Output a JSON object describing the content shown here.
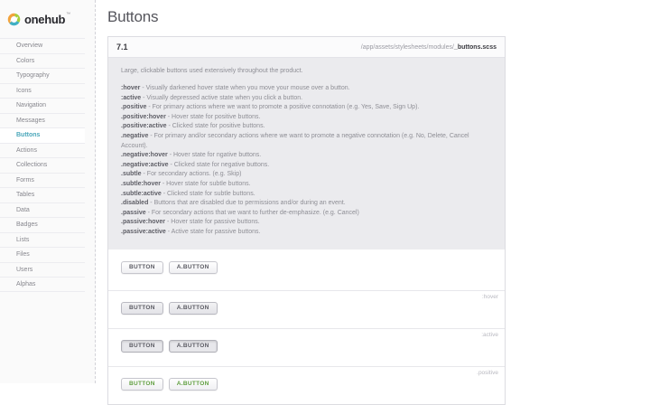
{
  "theme": {
    "accent_teal": "#4ba7ba",
    "positive_green": "#5f9e3e"
  },
  "brand": {
    "name": "onehub",
    "tm": "™"
  },
  "sidebar": {
    "items": [
      {
        "label": "Overview",
        "active": false
      },
      {
        "label": "Colors",
        "active": false
      },
      {
        "label": "Typography",
        "active": false
      },
      {
        "label": "Icons",
        "active": false
      },
      {
        "label": "Navigation",
        "active": false
      },
      {
        "label": "Messages",
        "active": false
      },
      {
        "label": "Buttons",
        "active": true
      },
      {
        "label": "Actions",
        "active": false
      },
      {
        "label": "Collections",
        "active": false
      },
      {
        "label": "Forms",
        "active": false
      },
      {
        "label": "Tables",
        "active": false
      },
      {
        "label": "Data",
        "active": false
      },
      {
        "label": "Badges",
        "active": false
      },
      {
        "label": "Lists",
        "active": false
      },
      {
        "label": "Files",
        "active": false
      },
      {
        "label": "Users",
        "active": false
      },
      {
        "label": "Alphas",
        "active": false
      }
    ]
  },
  "page": {
    "title": "Buttons"
  },
  "section": {
    "number": "7.1",
    "path_prefix": "/app/assets/stylesheets/modules/",
    "path_file": "_buttons.scss",
    "intro": "Large, clickable buttons used extensively throughout the product.",
    "definitions": [
      {
        "term": ":hover",
        "desc": "- Visually darkened hover state when you move your mouse over a button."
      },
      {
        "term": ":active",
        "desc": "- Visually depressed active state when you click a button."
      },
      {
        "term": ".positive",
        "desc": "- For primary actions where we want to promote a positive connotation (e.g. Yes, Save, Sign Up)."
      },
      {
        "term": ".positive:hover",
        "desc": "- Hover state for positive buttons."
      },
      {
        "term": ".positive:active",
        "desc": "- Clicked state for positive buttons."
      },
      {
        "term": ".negative",
        "desc": "- For primary and/or secondary actions where we want to promote a negative connotation (e.g. No, Delete, Cancel Account)."
      },
      {
        "term": ".negative:hover",
        "desc": "- Hover state for ngative buttons."
      },
      {
        "term": ".negative:active",
        "desc": "- Clicked state for negative buttons."
      },
      {
        "term": ".subtle",
        "desc": "- For secondary actions. (e.g. Skip)"
      },
      {
        "term": ".subtle:hover",
        "desc": "- Hover state for subtle buttons."
      },
      {
        "term": ".subtle:active",
        "desc": "- Clicked state for subtle buttons."
      },
      {
        "term": ".disabled",
        "desc": "- Buttons that are disabled due to permissions and/or during an event."
      },
      {
        "term": ".passive",
        "desc": "- For secondary actions that we want to further de-emphasize. (e.g. Cancel)"
      },
      {
        "term": ".passive:hover",
        "desc": "- Hover state for passive buttons."
      },
      {
        "term": ".passive:active",
        "desc": "- Active state for passive buttons."
      }
    ],
    "examples": [
      {
        "label": "",
        "state": "default",
        "buttons": [
          "BUTTON",
          "A.BUTTON"
        ]
      },
      {
        "label": ":hover",
        "state": "hover",
        "buttons": [
          "BUTTON",
          "A.BUTTON"
        ]
      },
      {
        "label": ":active",
        "state": "active",
        "buttons": [
          "BUTTON",
          "A.BUTTON"
        ]
      },
      {
        "label": ".positive",
        "state": "positive",
        "buttons": [
          "BUTTON",
          "A.BUTTON"
        ]
      }
    ]
  }
}
